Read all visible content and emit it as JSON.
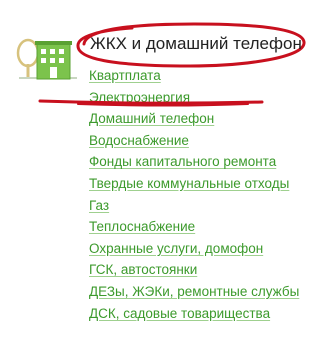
{
  "category": {
    "title": "ЖКХ и домашний телефон",
    "icon": "house-with-tree-icon",
    "highlight_color": "#c8101e",
    "link_color": "#3c9a2c"
  },
  "links": [
    {
      "label": "Квартплата"
    },
    {
      "label": "Электроэнергия"
    },
    {
      "label": "Домашний телефон"
    },
    {
      "label": "Водоснабжение"
    },
    {
      "label": "Фонды капитального ремонта"
    },
    {
      "label": "Твердые коммунальные отходы"
    },
    {
      "label": "Газ"
    },
    {
      "label": "Теплоснабжение"
    },
    {
      "label": "Охранные услуги, домофон"
    },
    {
      "label": "ГСК, автостоянки"
    },
    {
      "label": "ДЕЗы, ЖЭКи, ремонтные службы"
    },
    {
      "label": "ДСК, садовые товарищества"
    }
  ]
}
